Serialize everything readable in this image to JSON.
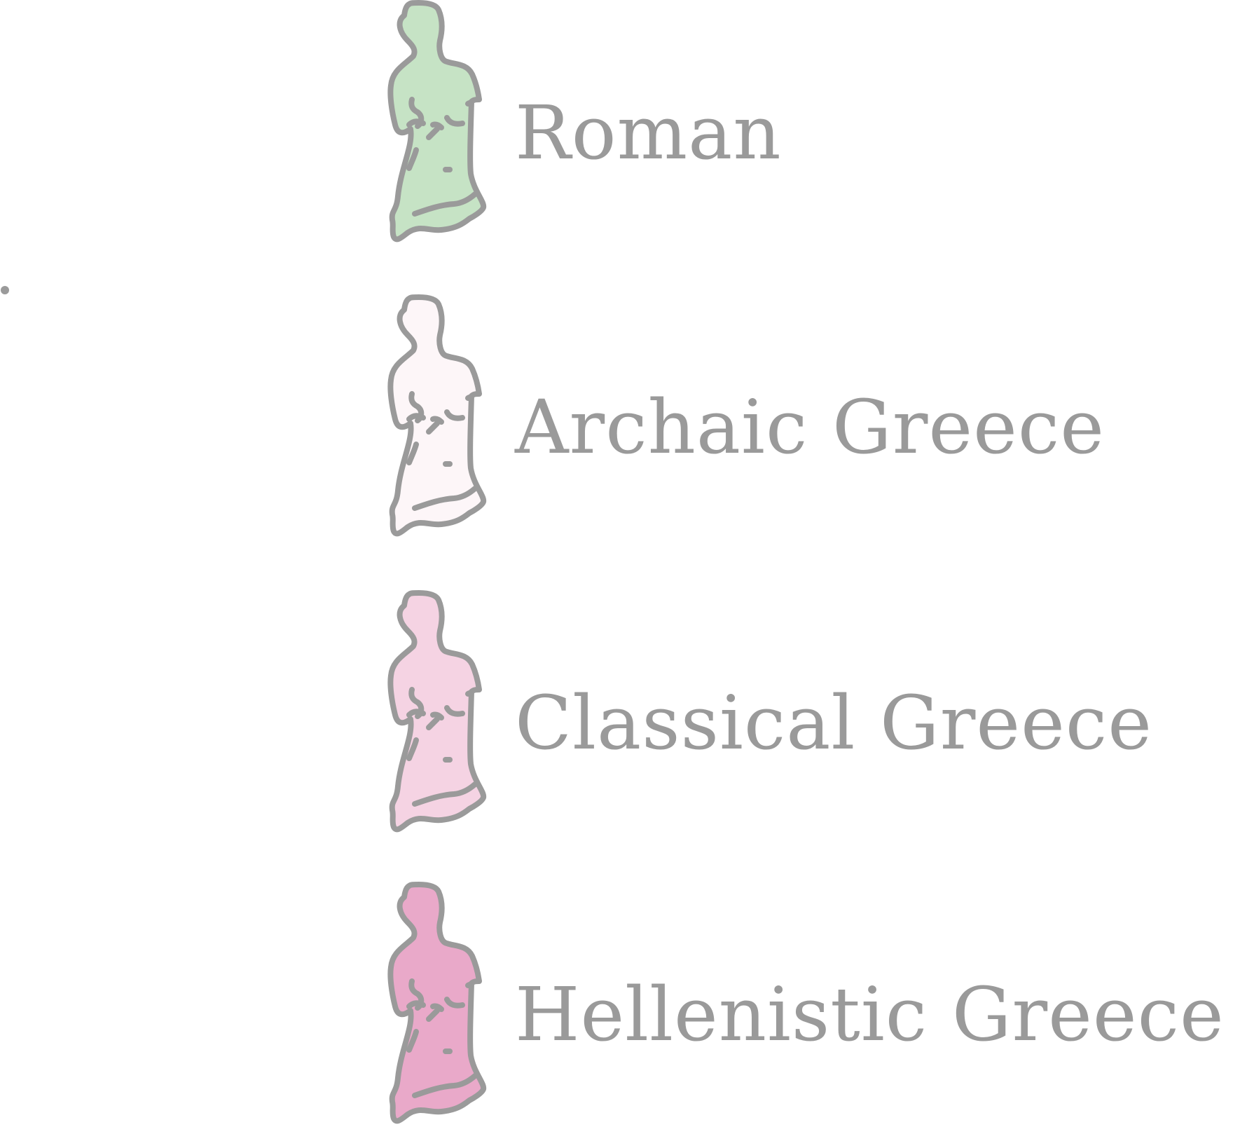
{
  "legend": {
    "items": [
      {
        "label": "Archaic Greece",
        "icon": "statue-icon",
        "fill": "#fdf6f8"
      },
      {
        "label": "Classical Greece",
        "icon": "statue-icon",
        "fill": "#f5d3e3"
      },
      {
        "label": "Hellenistic Greece",
        "icon": "statue-icon",
        "fill": "#e9a9c9"
      },
      {
        "label": "Roman",
        "icon": "statue-icon",
        "fill": "#c6e3c5"
      }
    ],
    "outline_color": "#9a9a9a",
    "text_color": "#9a9a9a"
  }
}
